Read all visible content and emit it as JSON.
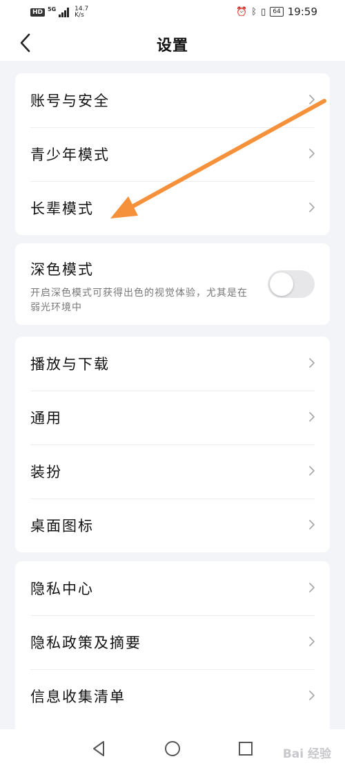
{
  "status_bar": {
    "hd": "HD",
    "network": "5G",
    "speed_value": "14.7",
    "speed_unit": "K/s",
    "battery": "64",
    "time": "19:59"
  },
  "header": {
    "title": "设置"
  },
  "account_group": [
    {
      "label": "账号与安全"
    },
    {
      "label": "青少年模式"
    },
    {
      "label": "长辈模式"
    }
  ],
  "dark_mode": {
    "title": "深色模式",
    "description": "开启深色模式可获得出色的视觉体验，尤其是在弱光环境中",
    "enabled": false
  },
  "general_group": [
    {
      "label": "播放与下载"
    },
    {
      "label": "通用"
    },
    {
      "label": "装扮"
    },
    {
      "label": "桌面图标"
    }
  ],
  "privacy_group": [
    {
      "label": "隐私中心"
    },
    {
      "label": "隐私政策及摘要"
    },
    {
      "label": "信息收集清单"
    }
  ],
  "colors": {
    "background": "#f3f4f8",
    "card": "#ffffff",
    "annotation_arrow": "#f5913a"
  },
  "watermark": "Bai 经验"
}
